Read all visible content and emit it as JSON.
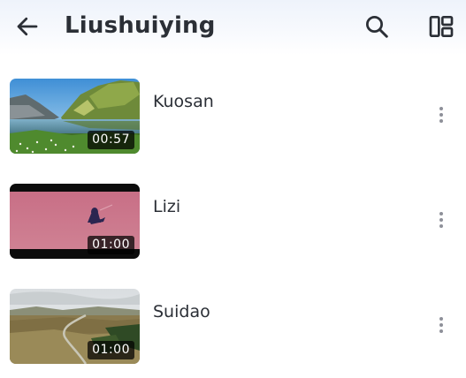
{
  "header": {
    "title": "Liushuiying",
    "back_icon": "arrow-left-icon",
    "search_icon": "search-icon",
    "layout_icon": "layout-toggle-icon"
  },
  "videos": [
    {
      "title": "Kuosan",
      "duration": "00:57",
      "thumbnail": "mountain-lake"
    },
    {
      "title": "Lizi",
      "duration": "01:00",
      "thumbnail": "pink-sky-figure"
    },
    {
      "title": "Suidao",
      "duration": "01:00",
      "thumbnail": "aerial-road-landscape"
    }
  ],
  "colors": {
    "text": "#2b2f36",
    "icon": "#2b2f36",
    "more_dots": "#8e9099",
    "duration_bg": "#000000"
  }
}
